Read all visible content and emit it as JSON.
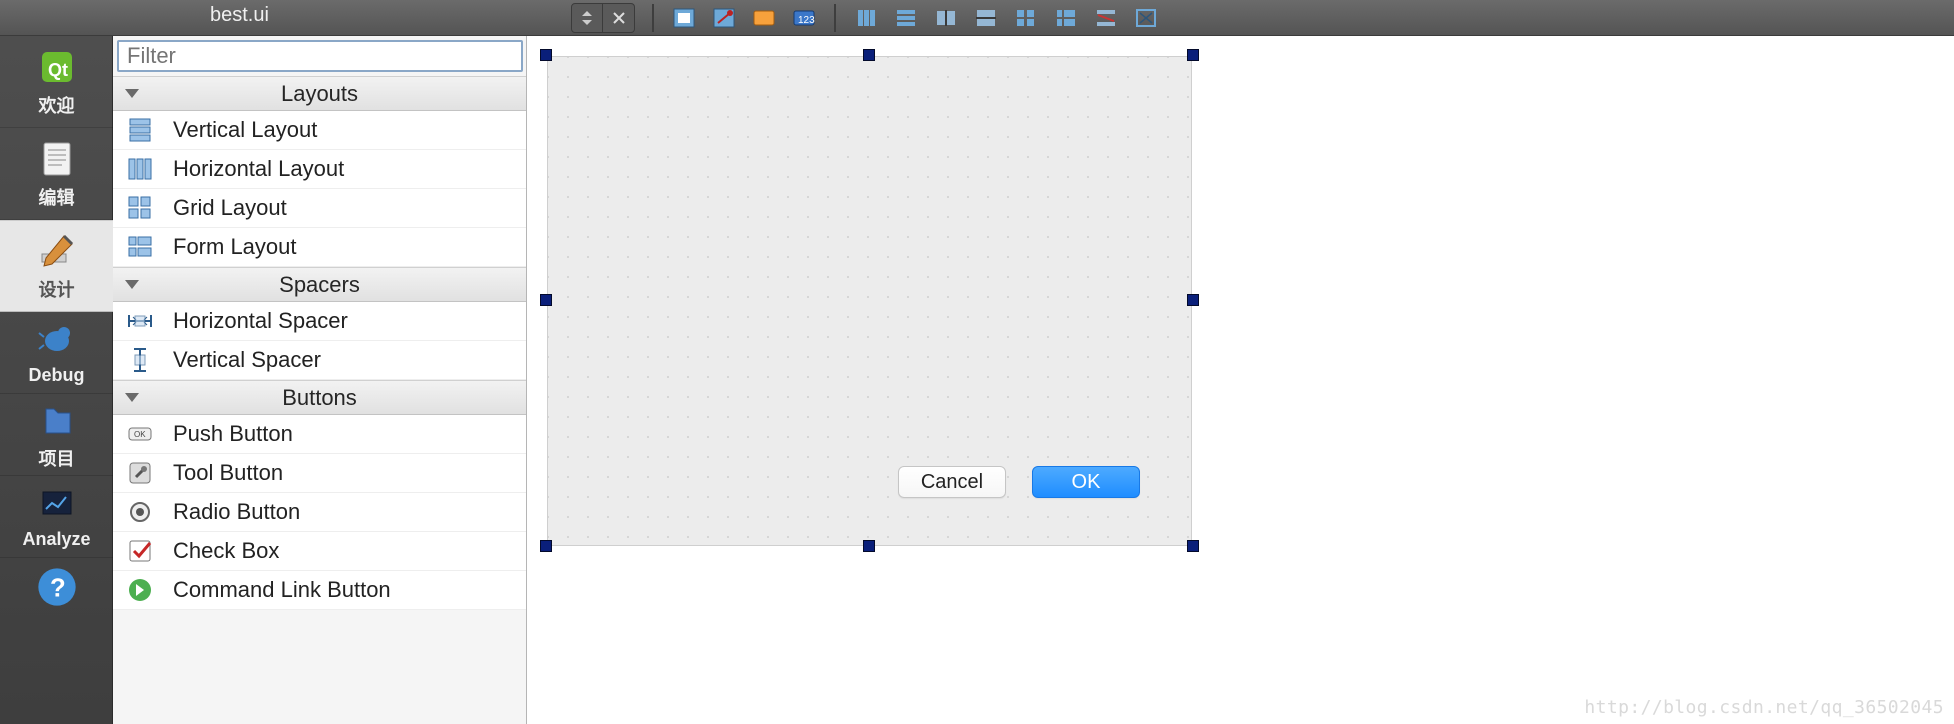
{
  "titlebar": {
    "title": "best.ui"
  },
  "toolbar_icons": [
    "edit-widgets-icon",
    "edit-signals-icon",
    "edit-buddies-icon",
    "edit-taborder-icon",
    "layout-horizontal-icon",
    "layout-vertical-icon",
    "layout-hsplit-icon",
    "layout-vsplit-icon",
    "layout-grid-icon",
    "layout-form-icon",
    "break-layout-icon",
    "adjust-size-icon"
  ],
  "modes": [
    {
      "id": "welcome",
      "label": "欢迎"
    },
    {
      "id": "edit",
      "label": "编辑"
    },
    {
      "id": "design",
      "label": "设计",
      "selected": true
    },
    {
      "id": "debug",
      "label": "Debug"
    },
    {
      "id": "project",
      "label": "项目"
    },
    {
      "id": "analyze",
      "label": "Analyze"
    },
    {
      "id": "help",
      "label": ""
    }
  ],
  "widgetbox": {
    "filter_placeholder": "Filter",
    "categories": [
      {
        "name": "Layouts",
        "items": [
          {
            "icon": "vlayout",
            "label": "Vertical Layout"
          },
          {
            "icon": "hlayout",
            "label": "Horizontal Layout"
          },
          {
            "icon": "gridlayout",
            "label": "Grid Layout"
          },
          {
            "icon": "formlayout",
            "label": "Form Layout"
          }
        ]
      },
      {
        "name": "Spacers",
        "items": [
          {
            "icon": "hspacer",
            "label": "Horizontal Spacer"
          },
          {
            "icon": "vspacer",
            "label": "Vertical Spacer"
          }
        ]
      },
      {
        "name": "Buttons",
        "items": [
          {
            "icon": "pushbutton",
            "label": "Push Button"
          },
          {
            "icon": "toolbutton",
            "label": "Tool Button"
          },
          {
            "icon": "radiobutton",
            "label": "Radio Button"
          },
          {
            "icon": "checkbox",
            "label": "Check Box"
          },
          {
            "icon": "commandlink",
            "label": "Command Link Button"
          }
        ]
      }
    ]
  },
  "form": {
    "buttons": {
      "cancel": "Cancel",
      "ok": "OK"
    }
  },
  "watermark": "http://blog.csdn.net/qq_36502045"
}
